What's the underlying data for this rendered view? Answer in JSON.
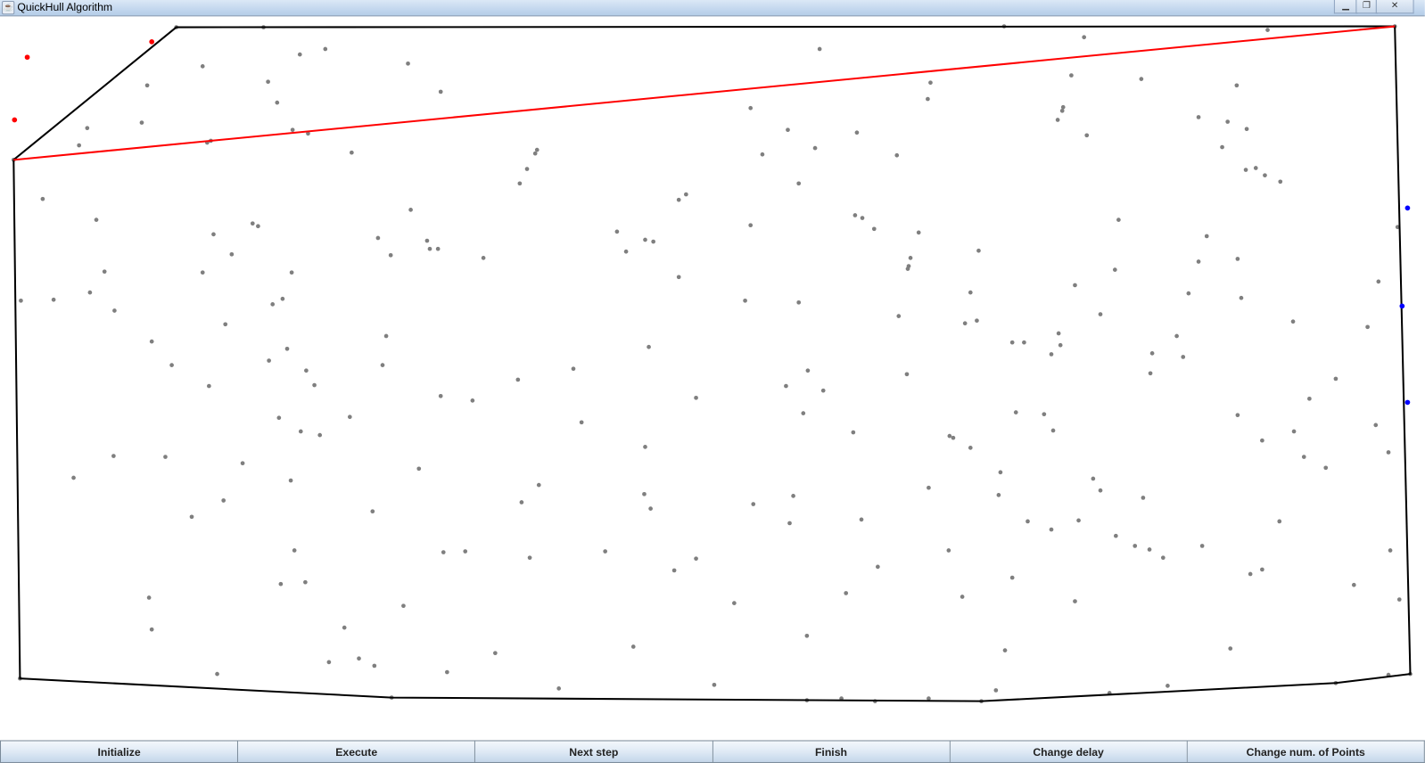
{
  "window": {
    "title": "QuickHull Algorithm"
  },
  "colors": {
    "hull": "#000000",
    "current_line": "#ff0000",
    "point": "#7f7f7f",
    "left_set": "#ff0000",
    "right_set": "#0000ff"
  },
  "buttons": [
    {
      "label": "Initialize"
    },
    {
      "label": "Execute"
    },
    {
      "label": "Next step"
    },
    {
      "label": "Finish"
    },
    {
      "label": "Change delay"
    },
    {
      "label": "Change num. of Points"
    }
  ]
}
